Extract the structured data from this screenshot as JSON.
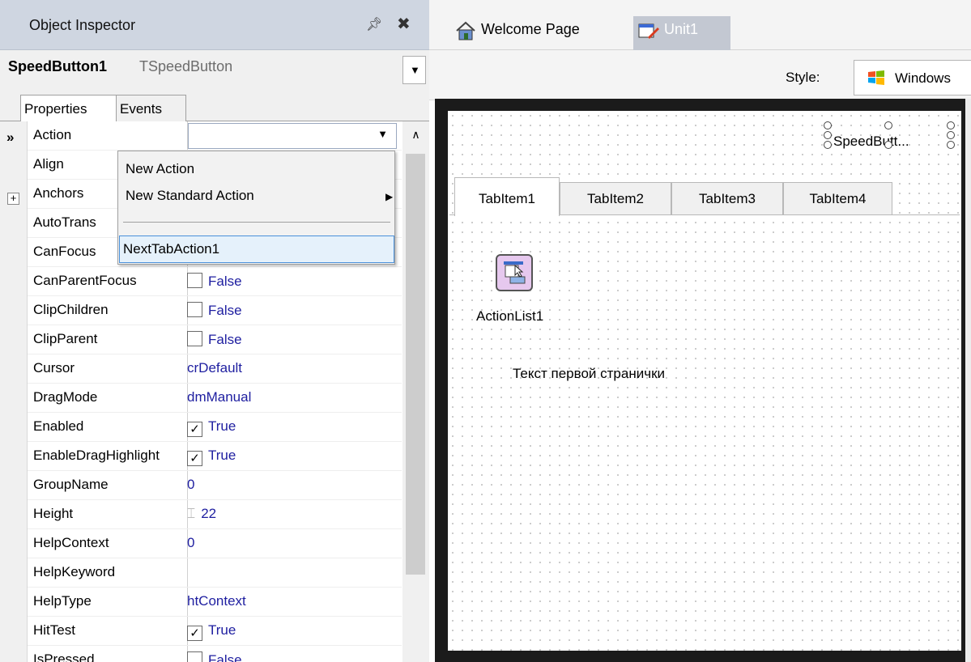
{
  "inspector": {
    "title": "Object Inspector",
    "component_name": "SpeedButton1",
    "component_type": "TSpeedButton",
    "tabs": [
      "Properties",
      "Events"
    ],
    "selected_marker": "»",
    "expand_symbol": "+",
    "properties": [
      {
        "name": "Action",
        "value": ""
      },
      {
        "name": "Align",
        "value": ""
      },
      {
        "name": "Anchors",
        "value": ""
      },
      {
        "name": "AutoTrans",
        "value": ""
      },
      {
        "name": "CanFocus",
        "value": ""
      },
      {
        "name": "CanParentFocus",
        "value": "False",
        "check": ""
      },
      {
        "name": "ClipChildren",
        "value": "False",
        "check": ""
      },
      {
        "name": "ClipParent",
        "value": "False",
        "check": ""
      },
      {
        "name": "Cursor",
        "value": "crDefault"
      },
      {
        "name": "DragMode",
        "value": "dmManual"
      },
      {
        "name": "Enabled",
        "value": "True",
        "check": "✓"
      },
      {
        "name": "EnableDragHighlight",
        "value": "True",
        "check": "✓"
      },
      {
        "name": "GroupName",
        "value": "0"
      },
      {
        "name": "Height",
        "value": "22"
      },
      {
        "name": "HelpContext",
        "value": "0"
      },
      {
        "name": "HelpKeyword",
        "value": ""
      },
      {
        "name": "HelpType",
        "value": "htContext"
      },
      {
        "name": "HitTest",
        "value": "True",
        "check": "✓"
      },
      {
        "name": "IsPressed",
        "value": "False",
        "check": ""
      }
    ],
    "action_dropdown": {
      "items": [
        "New Action",
        "New Standard Action",
        "NextTabAction1"
      ],
      "highlighted": "NextTabAction1"
    }
  },
  "editor": {
    "tabs": [
      "Welcome Page",
      "Unit1"
    ],
    "active_tab": "Unit1",
    "style_label": "Style:",
    "style_value": "Windows"
  },
  "form": {
    "speed_button_label": "SpeedButt...",
    "tab_items": [
      "TabItem1",
      "TabItem2",
      "TabItem3",
      "TabItem4"
    ],
    "active_tab_item": "TabItem1",
    "action_list_label": "ActionList1",
    "page_text": "Текст первой странички"
  }
}
